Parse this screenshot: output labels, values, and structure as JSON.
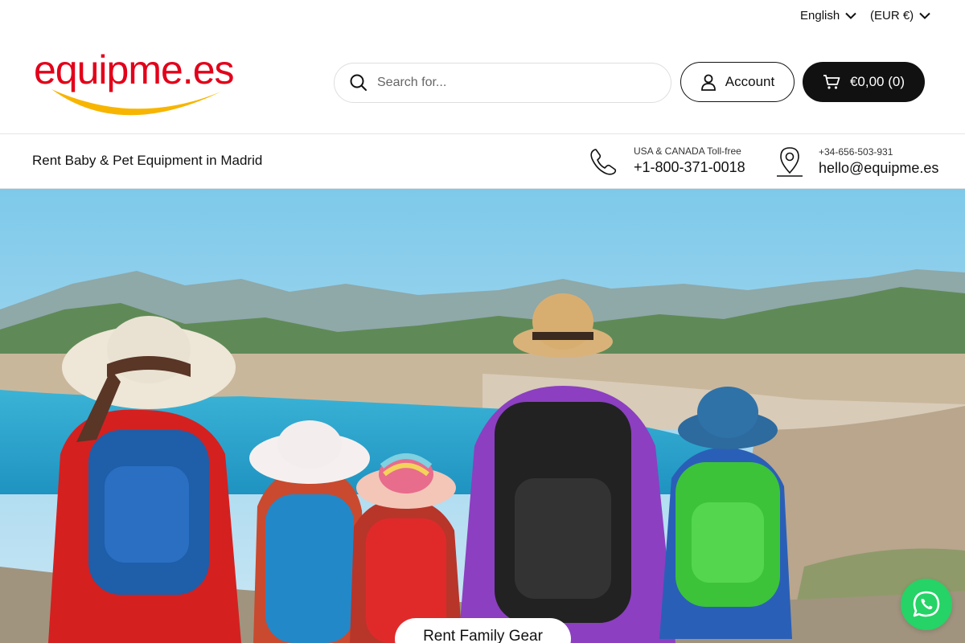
{
  "topbar": {
    "language": "English",
    "currency": "(EUR €)"
  },
  "header": {
    "logo_text": "equipme.es",
    "search_placeholder": "Search for...",
    "account_label": "Account",
    "cart_label": "€0,00 (0)"
  },
  "infobar": {
    "tagline": "Rent Baby & Pet Equipment in Madrid",
    "phone_caption": "USA & CANADA Toll-free",
    "phone_number": "+1-800-371-0018",
    "alt_phone": "+34-656-503-931",
    "email": "hello@equipme.es"
  },
  "hero": {
    "cta_label": "Rent Family Gear"
  },
  "colors": {
    "brand_red": "#e2001a",
    "brand_yellow": "#f7b500",
    "whatsapp_green": "#25d366",
    "dark": "#111111"
  },
  "icons": {
    "language_dropdown": "chevron-down-icon",
    "currency_dropdown": "chevron-down-icon",
    "search": "search-icon",
    "account": "user-icon",
    "cart": "cart-icon",
    "phone": "phone-icon",
    "location": "map-pin-icon",
    "chat": "whatsapp-icon"
  }
}
